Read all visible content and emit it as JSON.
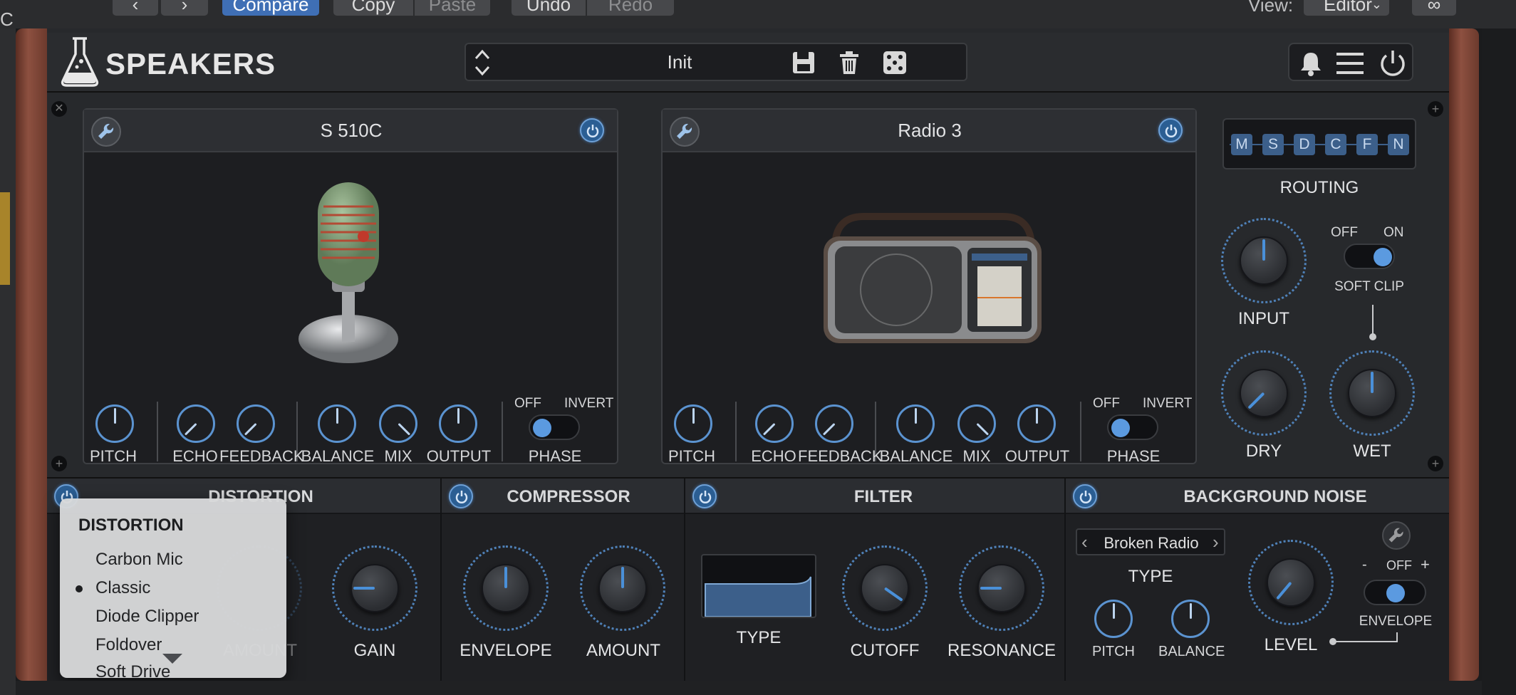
{
  "host": {
    "nav_back": "‹",
    "nav_forward": "›",
    "compare": "Compare",
    "copy": "Copy",
    "paste": "Paste",
    "undo": "Undo",
    "redo": "Redo",
    "view_label": "View:",
    "view_value": "Editor",
    "left_edge_text": "C"
  },
  "plugin": {
    "title": "SPEAKERS",
    "preset_name": "Init"
  },
  "speaker_a": {
    "name": "S 510C",
    "knobs": [
      "PITCH",
      "ECHO",
      "FEEDBACK",
      "BALANCE",
      "MIX",
      "OUTPUT"
    ],
    "phase_off": "OFF",
    "phase_invert": "INVERT",
    "phase_label": "PHASE"
  },
  "speaker_b": {
    "name": "Radio 3",
    "knobs": [
      "PITCH",
      "ECHO",
      "FEEDBACK",
      "BALANCE",
      "MIX",
      "OUTPUT"
    ],
    "phase_off": "OFF",
    "phase_invert": "INVERT",
    "phase_label": "PHASE"
  },
  "routing": {
    "buttons": [
      "M",
      "S",
      "D",
      "C",
      "F",
      "N"
    ],
    "label": "ROUTING",
    "input_label": "INPUT",
    "soft_clip_off": "OFF",
    "soft_clip_on": "ON",
    "soft_clip_label": "SOFT CLIP",
    "dry_label": "DRY",
    "wet_label": "WET"
  },
  "distortion": {
    "title": "DISTORTION",
    "amount_label": "AMOUNT",
    "gain_label": "GAIN"
  },
  "compressor": {
    "title": "COMPRESSOR",
    "envelope_label": "ENVELOPE",
    "amount_label": "AMOUNT"
  },
  "filter": {
    "title": "FILTER",
    "type_label": "TYPE",
    "cutoff_label": "CUTOFF",
    "resonance_label": "RESONANCE"
  },
  "background_noise": {
    "title": "BACKGROUND NOISE",
    "type_value": "Broken Radio",
    "type_label": "TYPE",
    "pitch_label": "PITCH",
    "balance_label": "BALANCE",
    "level_label": "LEVEL",
    "env_minus": "-",
    "env_off": "OFF",
    "env_plus": "+",
    "envelope_label": "ENVELOPE"
  },
  "dropdown": {
    "header": "DISTORTION",
    "items": [
      "Carbon Mic",
      "Classic",
      "Diode Clipper",
      "Foldover",
      "Soft Drive"
    ],
    "selected": "Classic"
  },
  "colors": {
    "accent": "#4a90d9",
    "active_button": "#3f6fb5",
    "wood": "#8d5040"
  }
}
